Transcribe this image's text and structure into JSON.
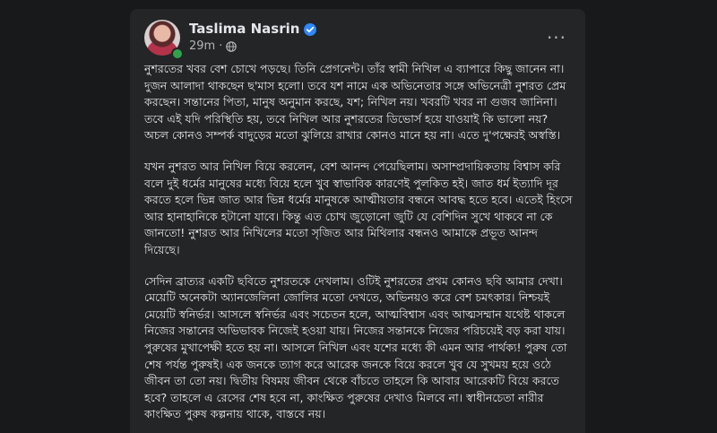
{
  "post": {
    "author": "Taslima Nasrin",
    "time": "29m",
    "separator": "·",
    "more_label": "···",
    "paragraphs": [
      "নুশরতের খবর বেশ চোখে পড়ছে। তিনি প্রেগনেন্ট। তাঁর স্বামী নিখিল এ ব্যাপারে কিছু জানেন না। দুজন আলাদা থাকছেন ছ'মাস হলো। তবে যশ নামে এক অভিনেতার সঙ্গে অভিনেত্রী নুশরত প্রেম করছেন। সন্তানের পিতা, মানুষ অনুমান করছে, যশ; নিখিল নয়। খবরটি খবর না গুজব জানিনা। তবে এই যদি পরিস্থিতি হয়, তবে নিখিল আর নুশরতের ডিভোর্স হয়ে যাওয়াই কি ভালো নয়? অচল কোনও সম্পর্ক বাদুড়ের মতো ঝুলিয়ে রাখার কোনও মানে হয় না। এতে দু'পক্ষেরই অস্বস্তি।",
      "যখন নুশরত আর নিখিল বিয়ে করলেন, বেশ আনন্দ পেয়েছিলাম। অসাম্প্রদায়িকতায় বিশ্বাস করি বলে দুই ধর্মের মানুষের মধ্যে বিয়ে হলে খুব স্বাভাবিক কারণেই পুলকিত হই। জাত ধর্ম ইত্যাদি দূর করতে হলে ভিন্ন জাত আর ভিন্ন ধর্মের মানুষকে আত্মীয়তার বন্ধনে আবদ্ধ হতে হবে। এতেই হিংসে আর হানাহানিকে হটানো যাবে। কিন্তু এত চোখ জুড়োনো জুটি যে বেশিদিন সুখে থাকবে না কে জানতো! নুশরত আর নিখিলের মতো সৃজিত আর মিথিলার বন্ধনও আমাকে প্রভূত আনন্দ দিয়েছে।",
      "সেদিন ব্রাত্যর একটি ছবিতে নুশরতকে দেখলাম। ওটিই নুশরতের প্রথম কোনও ছবি আমার দেখা। মেয়েটি অনেকটা অ্যানজেলিনা জোলির মতো দেখতে, অভিনয়ও করে বেশ চমৎকার। নিশ্চয়ই মেয়েটি স্বনির্ভর। আসলে স্বনির্ভর এবং সচেতন হলে, আত্মবিশ্বাস এবং আত্মসম্মান যথেষ্ট থাকলে নিজের সন্তানের অভিভাবক নিজেই হওয়া যায়। নিজের সন্তানকে নিজের পরিচয়েই বড় করা যায়। পুরুষের মুখাপেক্ষী হতে হয় না। আসলে নিখিল এবং যশের মধ্যে কী এমন আর পার্থক্য! পুরুষ তো শেষ পর্যন্ত পুরুষই। এক জনকে ত্যাগ করে আরেক জনকে বিয়ে করলে খুব যে সুখময় হয়ে ওঠে জীবন তা তো নয়। দ্বিতীয় বিষময় জীবন থেকে বাঁচতে তাহলে কি আবার আরেকটি বিয়ে করতে হবে? তাহলে এ রেসের শেষ হবে না, কাংক্ষিত পুরুষের দেখাও মিলবে না। স্বাধীনচেতা নারীর কাংক্ষিত পুরুষ কল্পনায় থাকে, বাস্তবে নয়।"
    ]
  },
  "icons": {
    "avatar": "profile-photo",
    "verified": "verified-badge-icon",
    "privacy": "globe-icon",
    "more": "more-horizontal-icon"
  },
  "colors": {
    "background": "#18191a",
    "card": "#242526",
    "text_primary": "#e4e6eb",
    "text_secondary": "#b0b3b8",
    "verified": "#2d88ff",
    "online": "#31a24c"
  }
}
